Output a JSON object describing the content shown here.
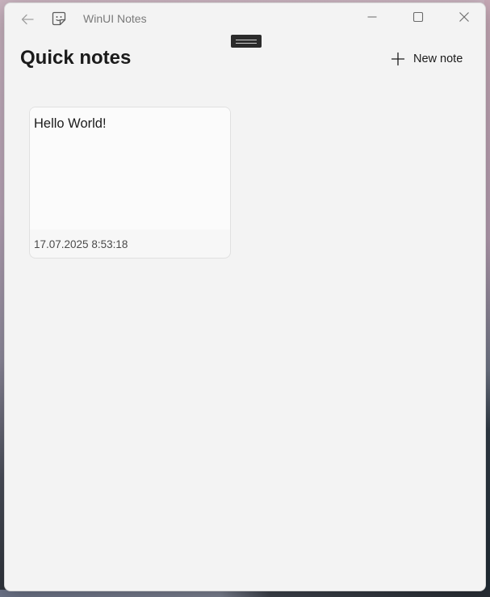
{
  "window": {
    "title": "WinUI Notes"
  },
  "titlebar": {
    "back_icon": "arrow-left-icon",
    "app_icon": "sticky-note-icon",
    "minimize_icon": "minimize-icon",
    "maximize_icon": "maximize-icon",
    "close_icon": "close-icon"
  },
  "header": {
    "title": "Quick notes",
    "new_note_label": "New note",
    "new_note_icon": "plus-icon"
  },
  "notes": [
    {
      "text": "Hello World!",
      "date": "17.07.2025 8:53:18"
    }
  ],
  "colors": {
    "window_bg": "#f3f3f3",
    "card_bg": "#fbfbfb",
    "text_primary": "#1b1b1b",
    "text_muted": "#7a7a7a"
  }
}
